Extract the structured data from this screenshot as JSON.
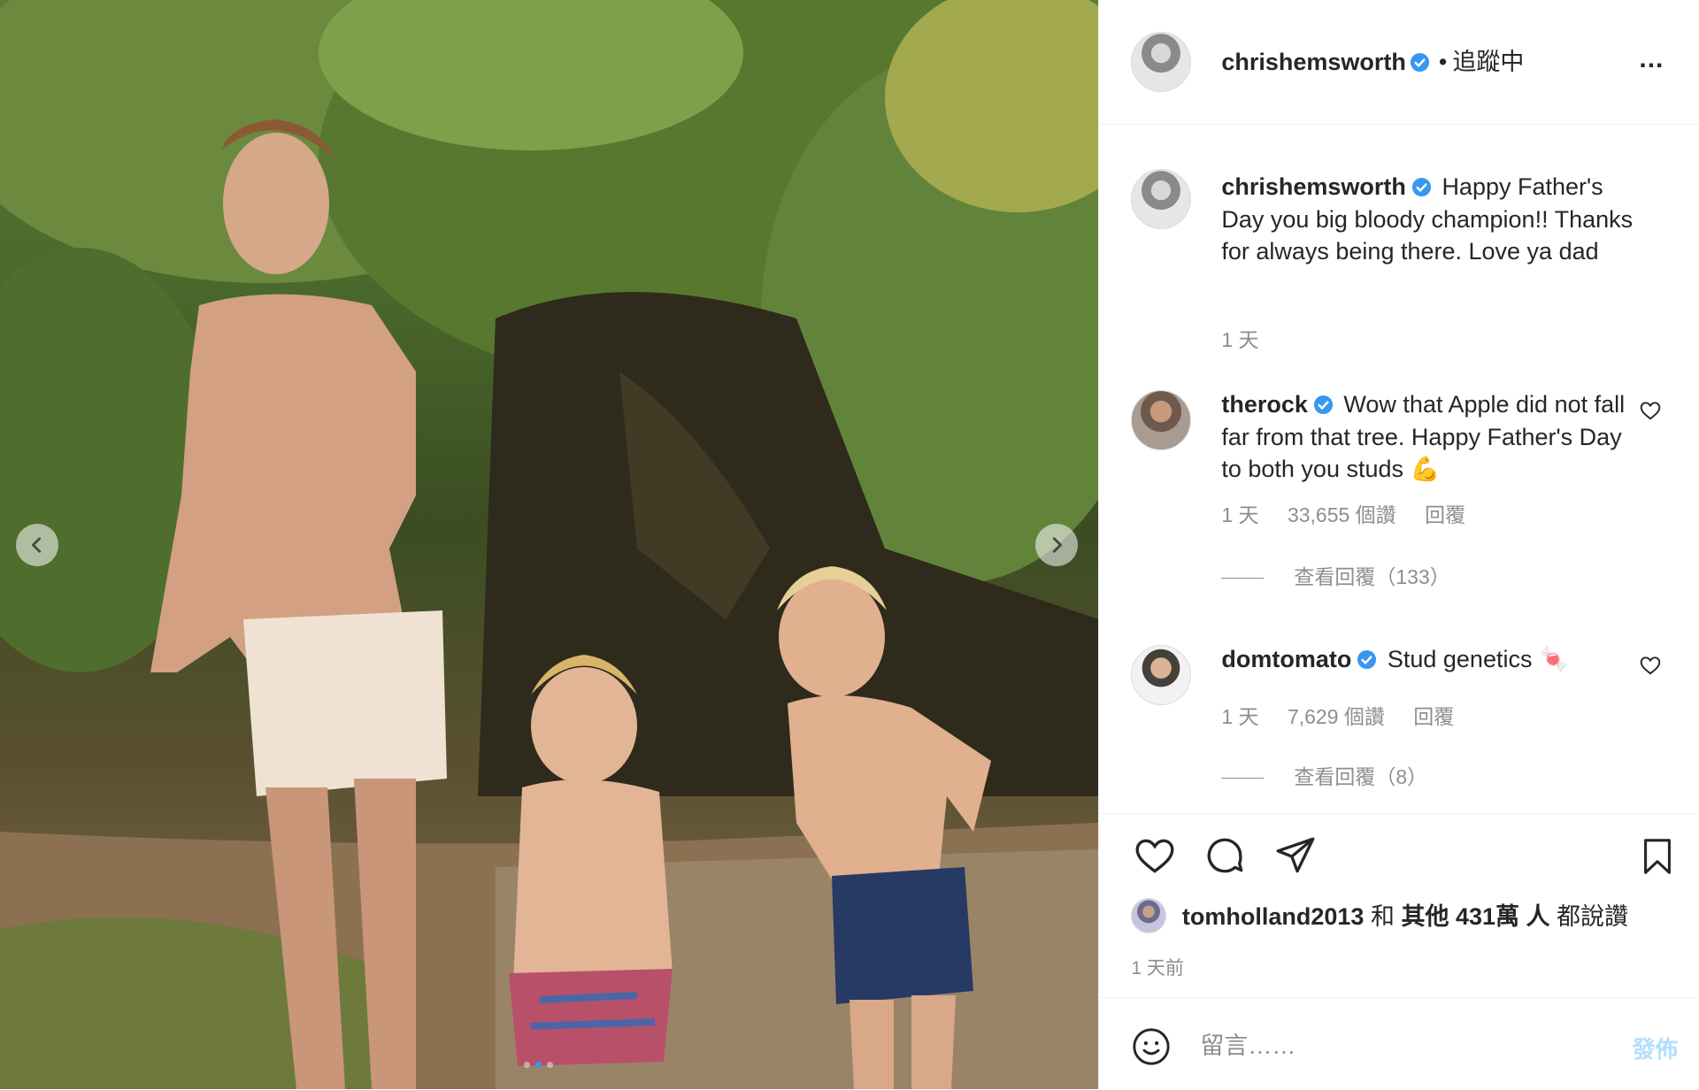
{
  "photo": {
    "alt_icon": "family-photo",
    "prev_icon": "chevron-left-icon",
    "next_icon": "chevron-right-icon",
    "carousel": {
      "count": 3,
      "active": 1
    }
  },
  "header": {
    "username": "chrishemsworth",
    "separator": "•",
    "follow_status": "追蹤中",
    "more_icon": "more-horizontal-icon",
    "more_label": "..."
  },
  "caption": {
    "username": "chrishemsworth",
    "text": "Happy Father's Day you big bloody champion!! Thanks for always being there. Love ya dad",
    "time": "1 天"
  },
  "comments": [
    {
      "username": "therock",
      "text": "Wow that Apple did not fall far from that tree. Happy Father's Day to both you studs 💪",
      "time": "1 天",
      "likes": "33,655 個讚",
      "reply": "回覆",
      "view_replies": "查看回覆（133）"
    },
    {
      "username": "domtomato",
      "text": "Stud genetics 🍬",
      "time": "1 天",
      "likes": "7,629 個讚",
      "reply": "回覆",
      "view_replies": "查看回覆（8）"
    }
  ],
  "actions": {
    "like_icon": "heart-icon",
    "comment_icon": "comment-icon",
    "share_icon": "paper-plane-icon",
    "save_icon": "bookmark-icon"
  },
  "likes": {
    "user": "tomholland2013",
    "connector": "和",
    "others": "其他 431萬 人",
    "suffix": "都說讚"
  },
  "posted": "1 天前",
  "compose": {
    "placeholder": "留言……",
    "post_label": "發佈",
    "emoji_icon": "smiley-icon"
  },
  "colors": {
    "verified": "#3897f0",
    "muted": "#8e8e8e",
    "post_disabled": "#b2dffc",
    "border": "#efefef"
  }
}
